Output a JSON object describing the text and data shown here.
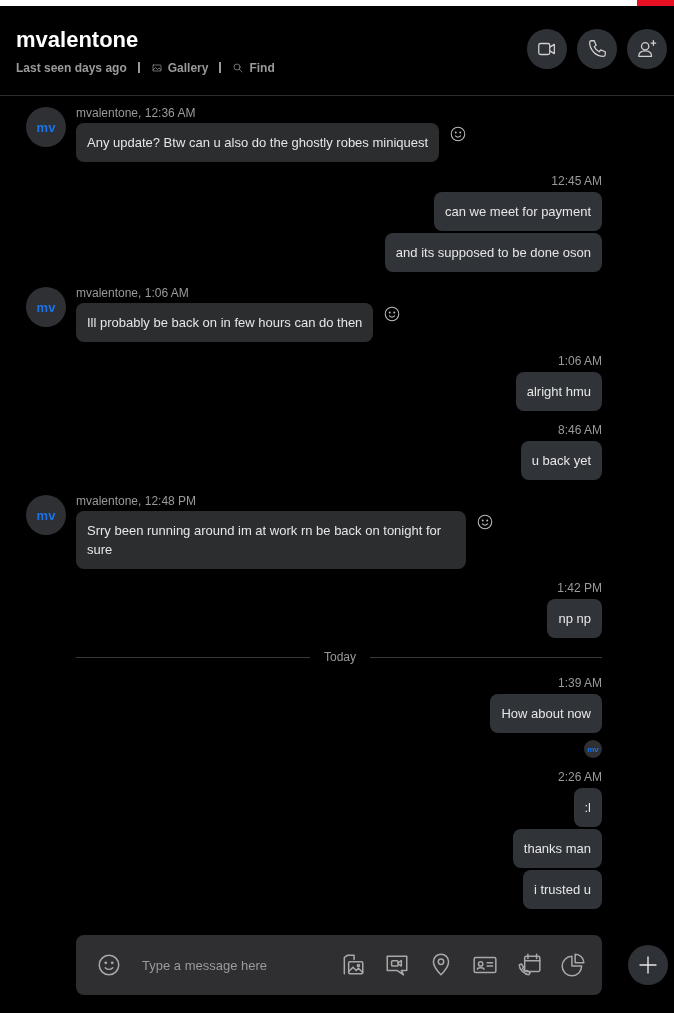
{
  "header": {
    "title": "mvalentone",
    "status": "Last seen days ago",
    "links": [
      "Gallery",
      "Find"
    ]
  },
  "messages": [
    {
      "kind": "incoming",
      "avatar": "mv",
      "meta": "mvalentone, 12:36 AM",
      "bubbles": [
        "Any update? Btw can u also do the ghostly robes miniquest"
      ]
    },
    {
      "kind": "outgoing",
      "time": "12:45 AM",
      "bubbles": [
        "can we meet for payment",
        "and its supposed to be done oson"
      ]
    },
    {
      "kind": "incoming",
      "avatar": "mv",
      "meta": "mvalentone, 1:06 AM",
      "bubbles": [
        "Ill probably be back on in few hours can do then"
      ]
    },
    {
      "kind": "outgoing",
      "time": "1:06 AM",
      "bubbles": [
        "alright hmu"
      ]
    },
    {
      "kind": "outgoing",
      "time": "8:46 AM",
      "bubbles": [
        "u back yet"
      ]
    },
    {
      "kind": "incoming",
      "avatar": "mv",
      "meta": "mvalentone, 12:48 PM",
      "bubbles": [
        "Srry been running around im at work rn be back on tonight for sure"
      ]
    },
    {
      "kind": "outgoing",
      "time": "1:42 PM",
      "bubbles": [
        "np np"
      ]
    },
    {
      "kind": "divider",
      "label": "Today"
    },
    {
      "kind": "outgoing",
      "time": "1:39 AM",
      "bubbles": [
        "How about now"
      ],
      "seen_by": "mv"
    },
    {
      "kind": "outgoing",
      "time": "2:26 AM",
      "bubbles": [
        ":l",
        "thanks man",
        "i trusted u"
      ]
    }
  ],
  "composer": {
    "placeholder": "Type a message here"
  }
}
